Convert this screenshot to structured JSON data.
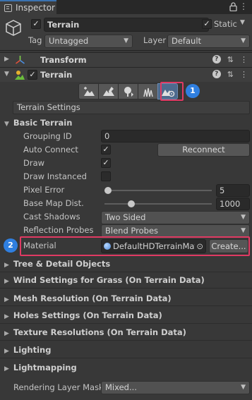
{
  "tab": {
    "title": "Inspector"
  },
  "header": {
    "object_name": "Terrain",
    "static_label": "Static",
    "tag_label": "Tag",
    "tag_value": "Untagged",
    "layer_label": "Layer",
    "layer_value": "Default"
  },
  "components": {
    "transform": "Transform",
    "terrain": "Terrain"
  },
  "badges": {
    "one": "1",
    "two": "2"
  },
  "section_title": "Terrain Settings",
  "basic_terrain": {
    "heading": "Basic Terrain",
    "grouping_id_label": "Grouping ID",
    "grouping_id_value": "0",
    "auto_connect_label": "Auto Connect",
    "reconnect_button": "Reconnect",
    "draw_label": "Draw",
    "draw_instanced_label": "Draw Instanced",
    "pixel_error_label": "Pixel Error",
    "pixel_error_value": "5",
    "pixel_error_fraction": 0.03,
    "base_map_dist_label": "Base Map Dist.",
    "base_map_dist_value": "1000",
    "base_map_dist_fraction": 0.25,
    "cast_shadows_label": "Cast Shadows",
    "cast_shadows_value": "Two Sided",
    "reflection_probes_label": "Reflection Probes",
    "reflection_probes_value": "Blend Probes",
    "material_label": "Material",
    "material_value": "DefaultHDTerrainMate",
    "create_button": "Create..."
  },
  "foldouts": {
    "tree_detail": "Tree & Detail Objects",
    "wind": "Wind Settings for Grass (On Terrain Data)",
    "mesh_resolution": "Mesh Resolution (On Terrain Data)",
    "holes": "Holes Settings (On Terrain Data)",
    "texture_resolutions": "Texture Resolutions (On Terrain Data)",
    "lighting": "Lighting",
    "lightmapping": "Lightmapping"
  },
  "rendering_layer_mask": {
    "label": "Rendering Layer Mask",
    "value": "Mixed..."
  },
  "colors": {
    "highlight": "#e03a63",
    "badge": "#2f7fe0",
    "accent": "#3a72b0"
  }
}
